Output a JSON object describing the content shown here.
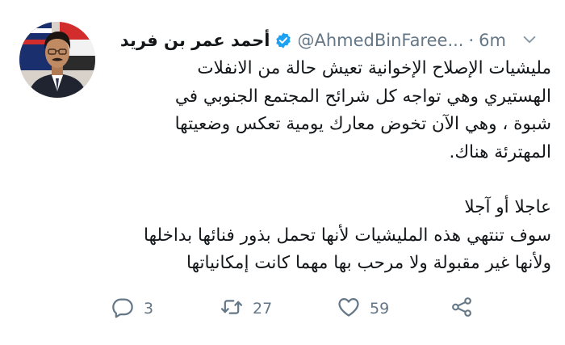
{
  "tweet": {
    "display_name": "أحمد عمر بن فريد",
    "handle": "@AhmedBinFaree...",
    "separator": "·",
    "time": "6m",
    "body_paragraphs": [
      [
        "مليشيات الإصلاح الإخوانية تعيش حالة من الانفلات",
        "الهستيري وهي تواجه كل شرائح المجتمع الجنوبي في",
        "شبوة ، وهي الآن تخوض معارك يومية تعكس وضعيتها",
        "المهترئة هناك."
      ],
      [
        "عاجلا أو آجلا",
        "سوف تنتهي هذه المليشيات لأنها تحمل بذور فنائها بداخلها",
        "ولأنها غير مقبولة ولا مرحب بها مهما كانت إمكانياتها"
      ]
    ],
    "actions": {
      "replies": "3",
      "retweets": "27",
      "likes": "59"
    },
    "icons": {
      "verified": "verified-badge-icon",
      "menu": "chevron-down-icon",
      "reply": "reply-icon",
      "retweet": "retweet-icon",
      "like": "heart-icon",
      "share": "share-icon"
    },
    "colors": {
      "text": "#14171a",
      "secondary": "#657786",
      "verified": "#1da1f2"
    }
  }
}
